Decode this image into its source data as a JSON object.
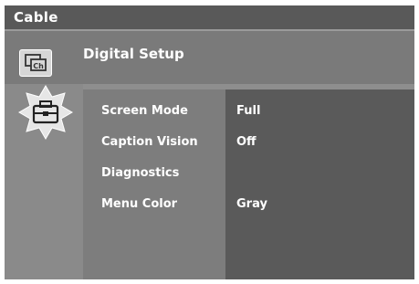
{
  "title_bar": {
    "title": "Cable"
  },
  "menu": {
    "heading": "Digital Setup",
    "items": [
      {
        "label": "Screen Mode",
        "value": "Full"
      },
      {
        "label": "Caption Vision",
        "value": "Off"
      },
      {
        "label": "Diagnostics",
        "value": ""
      },
      {
        "label": "Menu Color",
        "value": "Gray"
      }
    ]
  },
  "icons": {
    "channel_icon_text": "Ch",
    "channel_icon": "channel-setup-icon",
    "setup_icon": "toolbox-icon"
  },
  "colors": {
    "title_bar": "#595959",
    "header": "#7a7a7a",
    "menu_panel": "#7d7d7d",
    "value_panel": "#5a5a5a",
    "text": "#ffffff"
  }
}
